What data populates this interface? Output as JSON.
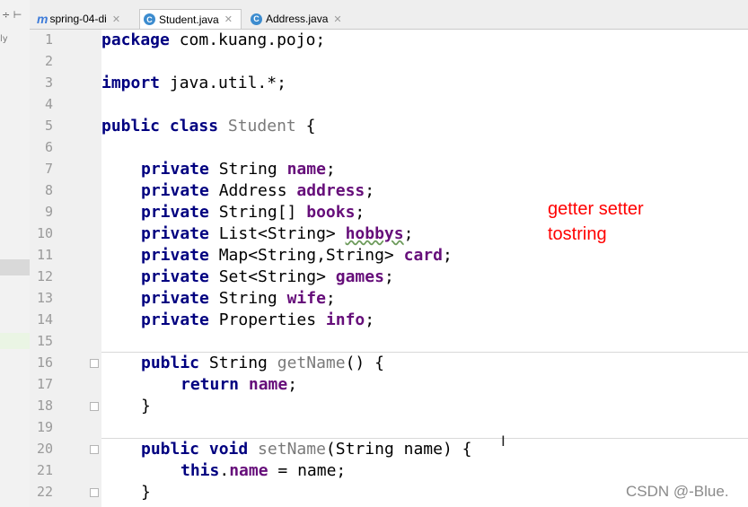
{
  "left_panel": {
    "frag_text": "ly",
    "ctrl_text": "÷ ⊢"
  },
  "tabs": [
    {
      "label": "spring-04-di",
      "icon": "m",
      "active": false
    },
    {
      "label": "Student.java",
      "icon": "C",
      "active": true
    },
    {
      "label": "Address.java",
      "icon": "C",
      "active": false
    }
  ],
  "line_numbers": [
    "1",
    "2",
    "3",
    "4",
    "5",
    "6",
    "7",
    "8",
    "9",
    "10",
    "11",
    "12",
    "13",
    "14",
    "15",
    "16",
    "17",
    "18",
    "19",
    "20",
    "21",
    "22"
  ],
  "code": {
    "l1_kw": "package",
    "l1_rest": " com.kuang.pojo;",
    "l3_kw": "import",
    "l3_rest": " java.util.*;",
    "l5_kw": "public class",
    "l5_name": " Student",
    "l5_rest": " {",
    "private": "private",
    "l7_type": " String ",
    "l7_field": "name",
    "l7_end": ";",
    "l8_type": " Address ",
    "l8_field": "address",
    "l8_end": ";",
    "l9_type": " String[] ",
    "l9_field": "books",
    "l9_end": ";",
    "l10_type": " List<String> ",
    "l10_field": "hobbys",
    "l10_end": ";",
    "l11_type": " Map<String,String> ",
    "l11_field": "card",
    "l11_end": ";",
    "l12_type": " Set<String> ",
    "l12_field": "games",
    "l12_end": ";",
    "l13_type": " String ",
    "l13_field": "wife",
    "l13_end": ";",
    "l14_type": " Properties ",
    "l14_field": "info",
    "l14_end": ";",
    "l16_kw": "public",
    "l16_type": " String ",
    "l16_name": "getName",
    "l16_rest": "() {",
    "l17_kw": "return",
    "l17_field": " name",
    "l17_end": ";",
    "l18": "}",
    "l20_kw": "public void",
    "l20_name": " setName",
    "l20_rest": "(String name) {",
    "l21_kw": "this",
    "l21_dot": ".",
    "l21_field": "name",
    "l21_rest": " = name;",
    "l22": "}"
  },
  "annotation": {
    "line1": "getter setter",
    "line2": "tostring"
  },
  "cursor_glyph": "I",
  "watermark": "CSDN @-Blue.",
  "colors": {
    "keyword": "#000080",
    "field": "#660e7a",
    "annotation": "#ff0000"
  }
}
